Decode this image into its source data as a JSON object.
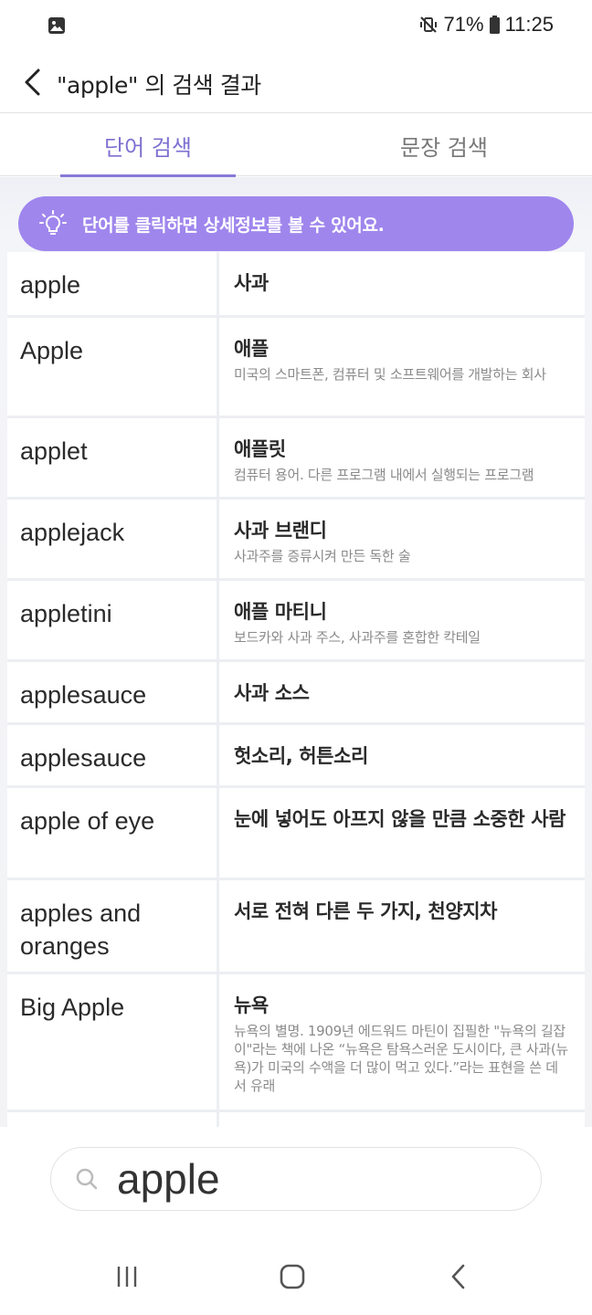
{
  "status_bar": {
    "battery": "71%",
    "time": "11:25"
  },
  "header": {
    "title": "\"apple\" 의 검색 결과"
  },
  "tabs": [
    {
      "label": "단어 검색",
      "active": true
    },
    {
      "label": "문장 검색",
      "active": false
    }
  ],
  "tip": {
    "text": "단어를 클릭하면 상세정보를 볼 수 있어요."
  },
  "results": [
    {
      "word": "apple",
      "meaning": "사과",
      "description": ""
    },
    {
      "word": "Apple",
      "meaning": "애플",
      "description": "미국의 스마트폰, 컴퓨터 및 소프트웨어를 개발하는 회사"
    },
    {
      "word": "applet",
      "meaning": "애플릿",
      "description": "컴퓨터 용어. 다른 프로그램 내에서 실행되는 프로그램"
    },
    {
      "word": "applejack",
      "meaning": "사과 브랜디",
      "description": "사과주를 증류시켜 만든 독한 술"
    },
    {
      "word": "appletini",
      "meaning": "애플 마티니",
      "description": "보드카와 사과 주스, 사과주를 혼합한 칵테일"
    },
    {
      "word": "applesauce",
      "meaning": "사과 소스",
      "description": ""
    },
    {
      "word": "applesauce",
      "meaning": "헛소리, 허튼소리",
      "description": ""
    },
    {
      "word": "apple of eye",
      "meaning": "눈에 넣어도 아프지 않을 만큼 소중한 사람",
      "description": ""
    },
    {
      "word": "apples and oranges",
      "meaning": "서로 전혀 다른 두 가지, 천양지차",
      "description": ""
    },
    {
      "word": "Big Apple",
      "meaning": "뉴욕",
      "description": "뉴욕의 별명. 1909년 에드워드 마틴이 집필한 \"뉴욕의 길잡이\"라는 책에 나온 “뉴욕은 탐욕스러운 도시이다, 큰 사과(뉴욕)가 미국의 수액을 더 많이 먹고 있다.”라는 표현을 쓴 데서 유래"
    }
  ],
  "search": {
    "value": "apple"
  },
  "colors": {
    "accent": "#8779d8",
    "banner": "#9f86ed"
  },
  "icons": {
    "back": "chevron-left-icon",
    "tip": "lightbulb-icon",
    "search": "search-icon"
  }
}
